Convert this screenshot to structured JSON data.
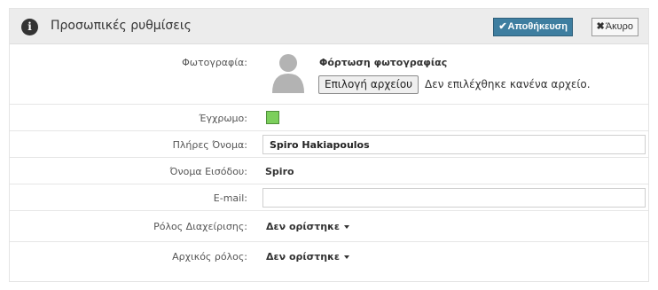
{
  "header": {
    "title": "Προσωπικές ρυθμίσεις",
    "save_label": "Αποθήκευση",
    "cancel_label": "Άκυρο",
    "info_glyph": "i",
    "save_glyph": "✔",
    "cancel_glyph": "✖"
  },
  "photo": {
    "label": "Φωτογραφία:",
    "upload_title": "Φόρτωση φωτογραφίας",
    "choose_file_label": "Επιλογή αρχείου",
    "file_status": "Δεν επιλέχθηκε κανένα αρχείο."
  },
  "color": {
    "label": "Έγχρωμο:",
    "value": "#7ccf5c"
  },
  "full_name": {
    "label": "Πλήρες Όνομα:",
    "value": "Spiro Hakiapoulos"
  },
  "login_name": {
    "label": "Όνομα Εισόδου:",
    "value": "Spiro"
  },
  "email": {
    "label": "E-mail:",
    "value": ""
  },
  "admin_role": {
    "label": "Ρόλος Διαχείρισης:",
    "value": "Δεν ορίστηκε"
  },
  "initial_role": {
    "label": "Αρχικός ρόλος:",
    "value": "Δεν ορίστηκε"
  },
  "colors": {
    "header_bg": "#ececec",
    "save_button": "#3e7ea0",
    "swatch": "#7ccf5c"
  }
}
